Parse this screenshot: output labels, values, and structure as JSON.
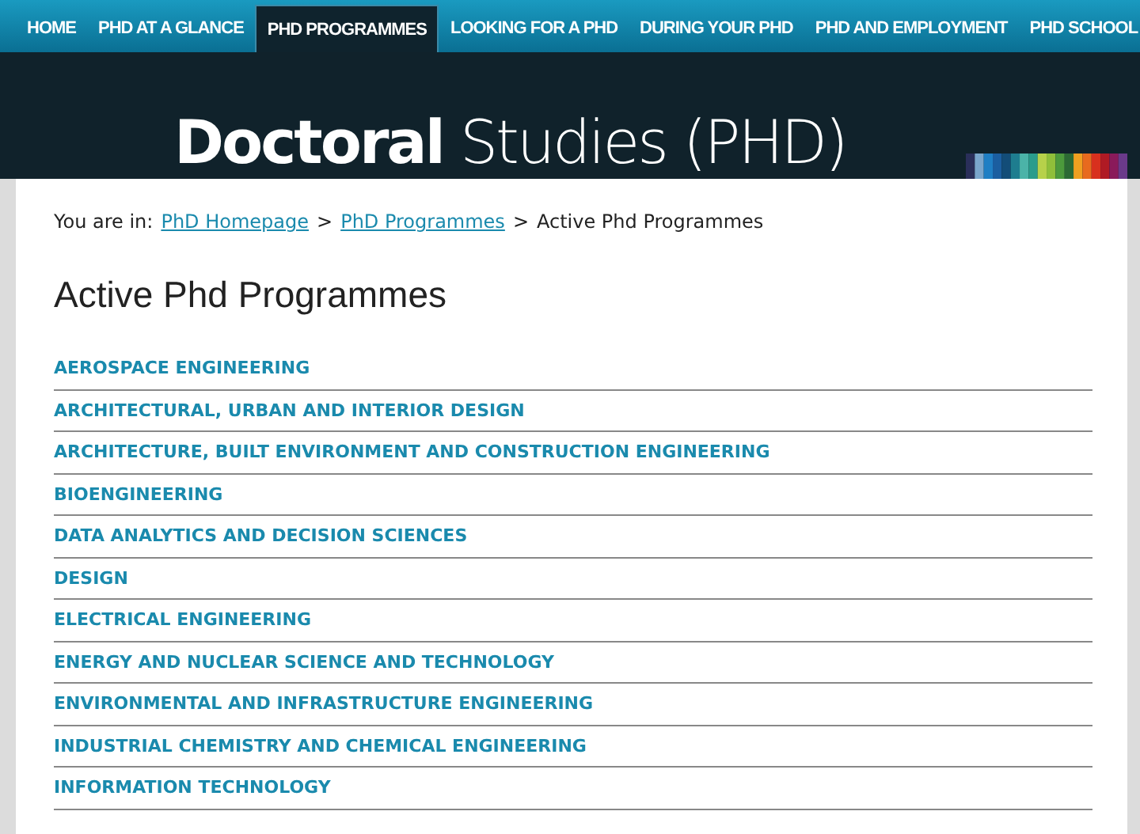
{
  "nav": [
    {
      "label": "HOME",
      "selected": false
    },
    {
      "label": "PHD AT A GLANCE",
      "selected": false
    },
    {
      "label": "PHD PROGRAMMES",
      "selected": true
    },
    {
      "label": "LOOKING FOR A PHD",
      "selected": false
    },
    {
      "label": "DURING YOUR PHD",
      "selected": false
    },
    {
      "label": "PHD AND EMPLOYMENT",
      "selected": false
    },
    {
      "label": "PHD SCHOOL",
      "selected": false
    }
  ],
  "banner": {
    "title_bold": "Doctoral",
    "title_light": "Studies (PHD)"
  },
  "breadcrumb": {
    "prefix": "You are in:",
    "links": [
      "PhD Homepage",
      "PhD Programmes"
    ],
    "separator": ">",
    "current": "Active Phd Programmes"
  },
  "heading": "Active Phd Programmes",
  "programmes": [
    "AEROSPACE ENGINEERING",
    "ARCHITECTURAL, URBAN AND INTERIOR DESIGN",
    "ARCHITECTURE, BUILT ENVIRONMENT AND CONSTRUCTION ENGINEERING",
    "BIOENGINEERING",
    "DATA ANALYTICS AND DECISION SCIENCES",
    "DESIGN",
    "ELECTRICAL ENGINEERING",
    "ENERGY AND NUCLEAR SCIENCE AND TECHNOLOGY",
    "ENVIRONMENTAL AND INFRASTRUCTURE ENGINEERING",
    "INDUSTRIAL CHEMISTRY AND CHEMICAL ENGINEERING",
    "INFORMATION TECHNOLOGY"
  ]
}
